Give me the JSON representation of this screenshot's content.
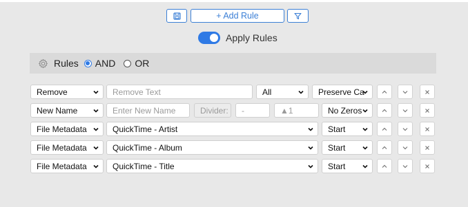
{
  "toolbar": {
    "add_rule_label": "+ Add Rule",
    "save_icon": "save-icon",
    "filter_icon": "filter-icon"
  },
  "apply_rules": {
    "label": "Apply Rules",
    "enabled": true
  },
  "rules_header": {
    "label": "Rules",
    "options": [
      {
        "label": "AND",
        "selected": true
      },
      {
        "label": "OR",
        "selected": false
      }
    ]
  },
  "rules": [
    {
      "type": "Remove",
      "text_placeholder": "Remove Text",
      "scope": "All",
      "case_option": "Preserve Ca"
    },
    {
      "type": "New Name",
      "name_placeholder": "Enter New Name",
      "divider_label": "Divider:",
      "divider_value": "-",
      "counter_start": "▲1",
      "zeros_option": "No Zeros"
    },
    {
      "type": "File Metadata",
      "field": "QuickTime - Artist",
      "position": "Start"
    },
    {
      "type": "File Metadata",
      "field": "QuickTime - Album",
      "position": "Start"
    },
    {
      "type": "File Metadata",
      "field": "QuickTime - Title",
      "position": "Start"
    }
  ],
  "colors": {
    "accent": "#2f7ae5",
    "panel_bg": "#e8e8e8",
    "header_bg": "#dadada"
  }
}
